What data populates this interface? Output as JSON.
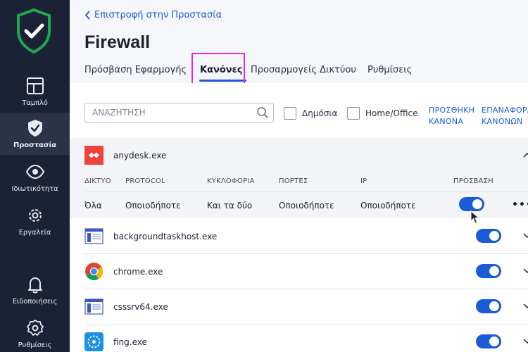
{
  "sidebar": {
    "items": [
      {
        "label": "Ταμπλό",
        "icon": "dashboard-icon"
      },
      {
        "label": "Προστασία",
        "icon": "shield-icon",
        "active": true
      },
      {
        "label": "Ιδιωτικότητα",
        "icon": "eye-icon"
      },
      {
        "label": "Εργαλεία",
        "icon": "gear-icon"
      },
      {
        "label": "Ειδοποιήσεις",
        "icon": "bell-icon"
      },
      {
        "label": "Ρυθμίσεις",
        "icon": "settings-icon"
      }
    ]
  },
  "header": {
    "back_label": "Επιστροφή στην Προστασία",
    "title": "Firewall",
    "tabs": [
      {
        "label": "Πρόσβαση Εφαρμογής"
      },
      {
        "label": "Κανόνες",
        "active": true
      },
      {
        "label": "Προσαρμογείς Δικτύου"
      },
      {
        "label": "Ρυθμίσεις"
      }
    ]
  },
  "toolbar": {
    "search_placeholder": "ΑΝΑΖΗΤΗΣΗ",
    "filters": [
      {
        "label": "Δημόσια",
        "checked": false
      },
      {
        "label": "Home/Office",
        "checked": false
      }
    ],
    "add_rule_line1": "ΠΡΟΣΘΗΚΗ",
    "add_rule_line2": "ΚΑΝΟΝΑ",
    "reset_line1": "ΕΠΑΝΑΦΟΡΑ",
    "reset_line2": "ΚΑΝΟΝΩΝ"
  },
  "rules": {
    "columns": {
      "network": "ΔΙΚΤΥΟ",
      "protocol": "PROTOCOL",
      "traffic": "ΚΥΚΛΟΦΟΡΙΑ",
      "ports": "ΠΟΡΤΕΣ",
      "ip": "IP",
      "access": "ΠΡΟΣΒΑΣΗ"
    },
    "expanded_rule": {
      "network": "Όλα",
      "protocol": "Οποιοδήποτε",
      "traffic": "Και τα δύο",
      "ports": "Οποιοδήποτε",
      "ip": "Οποιοδήποτε",
      "access_enabled": true,
      "more": "•••"
    },
    "apps": [
      {
        "name": "anydesk.exe",
        "icon": "anydesk-icon",
        "expanded": true
      },
      {
        "name": "backgroundtaskhost.exe",
        "icon": "window-app-icon",
        "enabled": true
      },
      {
        "name": "chrome.exe",
        "icon": "chrome-icon",
        "enabled": true
      },
      {
        "name": "csssrv64.exe",
        "icon": "window-app-icon",
        "enabled": true
      },
      {
        "name": "fing.exe",
        "icon": "fing-icon",
        "enabled": true
      }
    ]
  },
  "colors": {
    "sidebar_bg": "#1b2236",
    "accent": "#1a5bd6",
    "shield_green": "#1fa84f",
    "highlight": "#e528d6"
  }
}
